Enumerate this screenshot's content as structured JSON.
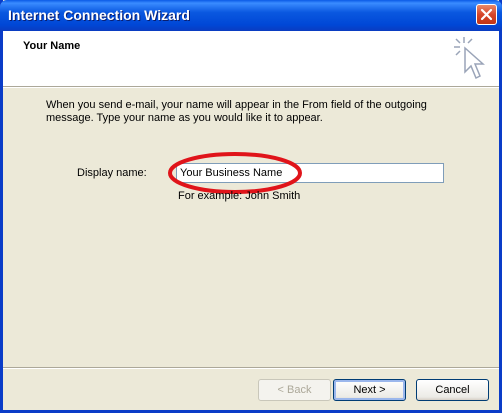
{
  "window": {
    "title": "Internet Connection Wizard"
  },
  "header": {
    "title": "Your Name"
  },
  "description": "When you send e-mail, your name will appear in the From field of the outgoing message. Type your name as you would like it to appear.",
  "form": {
    "display_name_label": "Display name:",
    "display_name_value": "Your Business Name",
    "example": "For example: John Smith"
  },
  "buttons": {
    "back": "< Back",
    "next": "Next >",
    "cancel": "Cancel"
  },
  "colors": {
    "titlebar": "#0a58e0",
    "dialog_bg": "#ece9d8",
    "highlight_oval": "#e0141a"
  },
  "icons": {
    "close": "close-icon",
    "wizard": "wizard-cursor-icon"
  }
}
